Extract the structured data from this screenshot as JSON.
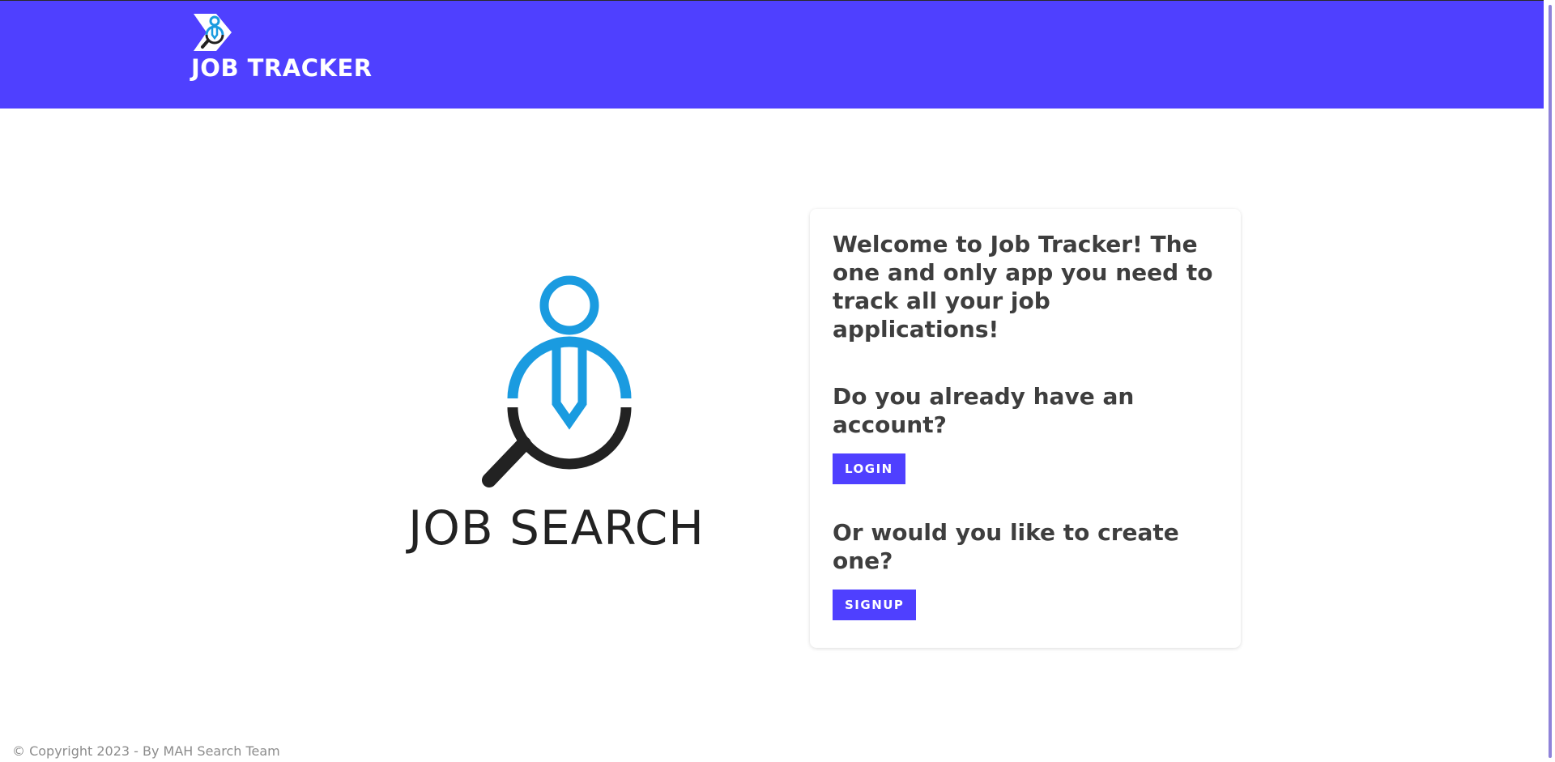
{
  "navbar": {
    "brand_title": "JOB TRACKER",
    "brand_icon": "job-search-logo-icon",
    "background_color": "#4f40ff"
  },
  "hero": {
    "logo_icon": "job-search-person-magnifier-icon",
    "logo_text": "JOB SEARCH",
    "colors": {
      "person": "#1a9be0",
      "magnifier": "#222222"
    }
  },
  "card": {
    "welcome_text": "Welcome to Job Tracker! The one and only app you need to track all your job applications!",
    "login_prompt": "Do you already have an account?",
    "login_label": "LOGIN",
    "signup_prompt": "Or would you like to create one?",
    "signup_label": "SIGNUP"
  },
  "footer": {
    "copyright": "© Copyright 2023 - By MAH Search Team"
  },
  "theme": {
    "accent": "#4f40ff",
    "text": "#3e3e3e"
  }
}
